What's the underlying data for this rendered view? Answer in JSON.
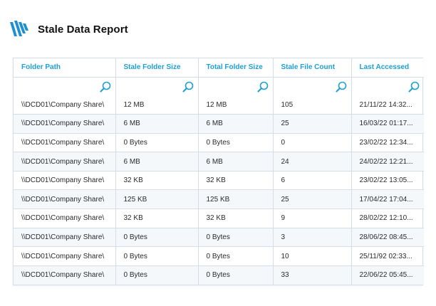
{
  "report": {
    "title": "Stale Data Report"
  },
  "colors": {
    "accent": "#1e9fd3",
    "border": "#d5dde6",
    "logo": "#1e8fd0"
  },
  "table": {
    "columns": [
      {
        "label": "Folder Path"
      },
      {
        "label": "Stale Folder Size"
      },
      {
        "label": "Total Folder Size"
      },
      {
        "label": "Stale File Count"
      },
      {
        "label": "Last Accessed"
      }
    ],
    "filter_icon": "search-icon",
    "rows": [
      {
        "path": "\\\\DCD01\\Company Share\\",
        "stale": "12 MB",
        "total": "12 MB",
        "count": "105",
        "last": "21/11/22 14:32..."
      },
      {
        "path": "\\\\DCD01\\Company Share\\",
        "stale": "6 MB",
        "total": "6 MB",
        "count": "25",
        "last": "16/03/22 01:17..."
      },
      {
        "path": "\\\\DCD01\\Company Share\\",
        "stale": "0 Bytes",
        "total": "0 Bytes",
        "count": "0",
        "last": "23/02/22 12:34..."
      },
      {
        "path": "\\\\DCD01\\Company Share\\",
        "stale": "6 MB",
        "total": "6 MB",
        "count": "24",
        "last": "24/02/22 12:21..."
      },
      {
        "path": "\\\\DCD01\\Company Share\\",
        "stale": "32 KB",
        "total": "32 KB",
        "count": "6",
        "last": "23/02/22 13:05..."
      },
      {
        "path": "\\\\DCD01\\Company Share\\",
        "stale": "125 KB",
        "total": "125 KB",
        "count": "25",
        "last": "17/04/22 17:04..."
      },
      {
        "path": "\\\\DCD01\\Company Share\\",
        "stale": "32 KB",
        "total": "32 KB",
        "count": "9",
        "last": "28/02/22 12:10..."
      },
      {
        "path": "\\\\DCD01\\Company Share\\",
        "stale": "0 Bytes",
        "total": "0 Bytes",
        "count": "3",
        "last": "28/06/22 08:45..."
      },
      {
        "path": "\\\\DCD01\\Company Share\\",
        "stale": "0 Bytes",
        "total": "0 Bytes",
        "count": "10",
        "last": "25/11/92 02:33..."
      },
      {
        "path": "\\\\DCD01\\Company Share\\",
        "stale": "0 Bytes",
        "total": "0 Bytes",
        "count": "33",
        "last": "22/06/22 05:45..."
      }
    ]
  }
}
